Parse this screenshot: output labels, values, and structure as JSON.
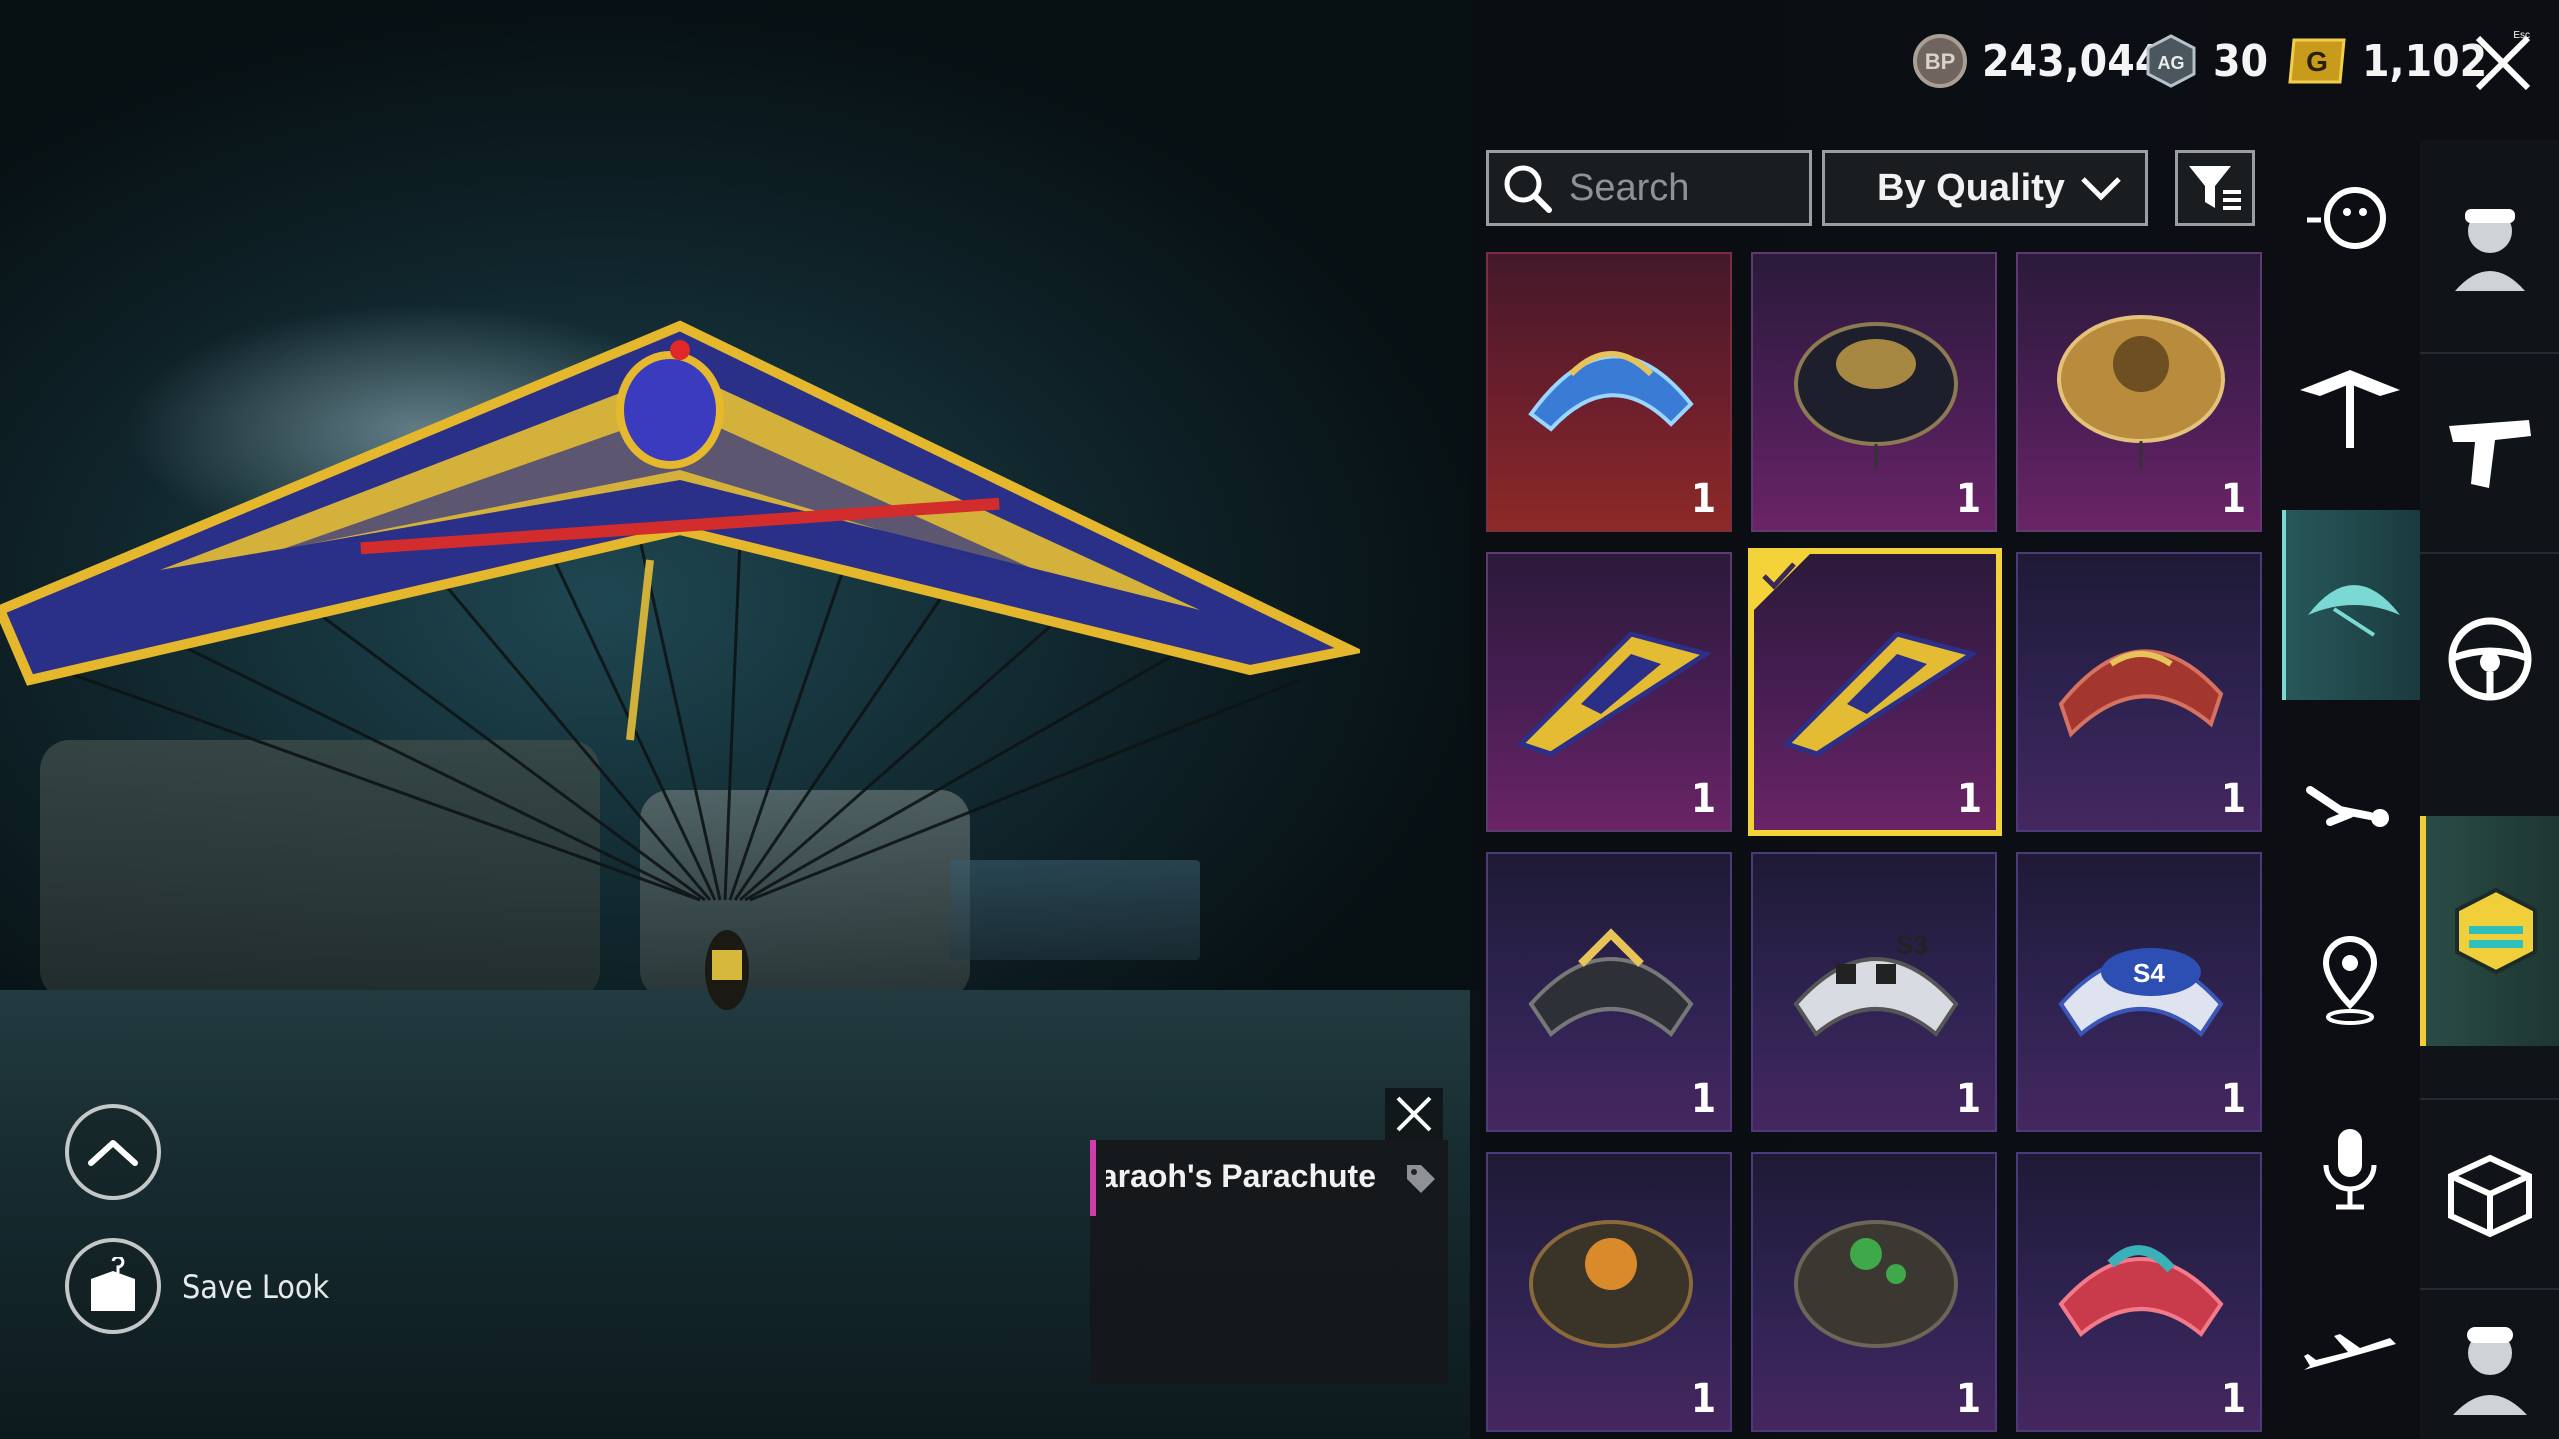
{
  "currency": {
    "bp": {
      "icon": "bp-coin-icon",
      "value": "243,044"
    },
    "ag": {
      "icon": "ag-token-icon",
      "value": "30"
    },
    "uc": {
      "icon": "g-coin-icon",
      "value": "1,102"
    }
  },
  "search": {
    "placeholder": "Search"
  },
  "sort": {
    "selected": "By Quality"
  },
  "items": [
    {
      "name": "blue-dragon-parachute",
      "quality": "red",
      "qty": "1"
    },
    {
      "name": "ornate-dark-parachute",
      "quality": "purple",
      "qty": "1"
    },
    {
      "name": "golden-pattern-parachute",
      "quality": "purple",
      "qty": "1"
    },
    {
      "name": "pharaoh-glider-a",
      "quality": "purple",
      "qty": "1"
    },
    {
      "name": "pharaoh-glider-b",
      "quality": "purple",
      "qty": "1",
      "selected": true
    },
    {
      "name": "red-striped-parachute",
      "quality": "violet",
      "qty": "1"
    },
    {
      "name": "dark-gold-parachute",
      "quality": "violet",
      "qty": "1"
    },
    {
      "name": "s3-checkered-parachute",
      "quality": "violet",
      "qty": "1"
    },
    {
      "name": "s4-blue-parachute",
      "quality": "violet",
      "qty": "1"
    },
    {
      "name": "s2-orange-parachute",
      "quality": "violet",
      "qty": "1"
    },
    {
      "name": "green-camo-parachute",
      "quality": "violet",
      "qty": "1"
    },
    {
      "name": "red-graffiti-parachute",
      "quality": "violet",
      "qty": "1"
    }
  ],
  "tooltip": {
    "title": "Pharaoh's Parachute ("
  },
  "save_look": {
    "label": "Save Look"
  },
  "close_hint": "Esc",
  "colors": {
    "selected": "#f3d23a",
    "accent_teal": "#7ad9d2",
    "tooltip_bar": "#d23ca8"
  },
  "tabs_left": [
    "emote-icon",
    "glider-icon",
    "parachute-icon",
    "skydive-icon",
    "location-pin-icon",
    "microphone-icon",
    "airplane-icon"
  ],
  "tabs_right": [
    "outfit-icon",
    "pistol-icon",
    "steering-wheel-icon",
    "hexagon-badge-icon",
    "crate-icon",
    "character-icon"
  ]
}
